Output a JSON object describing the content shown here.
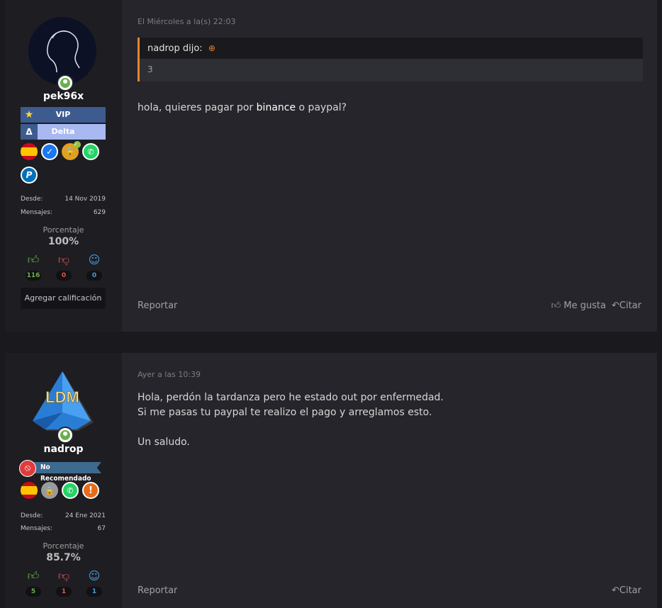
{
  "posts": [
    {
      "user": {
        "name": "pek96x",
        "banners": [
          {
            "label": "VIP",
            "bg": "#3d5b8f"
          },
          {
            "label": "Delta",
            "bg": "#a8b8f0",
            "icon": "Δ"
          }
        ],
        "badges": [
          "spain-flag-icon",
          "verified-icon",
          "lock-icon",
          "whatsapp-icon",
          "paypal-icon"
        ],
        "desde_label": "Desde:",
        "desde_value": "14 Nov 2019",
        "mensajes_label": "Mensajes:",
        "mensajes_value": "629",
        "porcentaje_label": "Porcentaje",
        "porcentaje_value": "100%",
        "votes": {
          "positive": "116",
          "negative": "0",
          "neutral": "0"
        },
        "rate_button": "Agregar calificación"
      },
      "date": "El Miércoles a la(s) 22:03",
      "quote": {
        "author": "nadrop dijo:",
        "text": "3"
      },
      "message": {
        "before": "hola, quieres pagar por ",
        "link": "binance",
        "after": " o paypal?"
      },
      "report": "Reportar",
      "like": "Me gusta",
      "cite": "Citar"
    },
    {
      "user": {
        "name": "nadrop",
        "avatar_text": "LDM",
        "banner": "No Recomendado",
        "badges": [
          "spain-flag-icon",
          "lock-gray-icon",
          "whatsapp-icon",
          "warning-icon"
        ],
        "desde_label": "Desde:",
        "desde_value": "24 Ene 2021",
        "mensajes_label": "Mensajes:",
        "mensajes_value": "67",
        "porcentaje_label": "Porcentaje",
        "porcentaje_value": "85.7%",
        "votes": {
          "positive": "5",
          "negative": "1",
          "neutral": "1"
        }
      },
      "date": "Ayer a las 10:39",
      "message_lines": [
        "Hola, perdón la tardanza pero he estado out por enfermedad.",
        "Si me pasas tu paypal te realizo el pago y arreglamos esto.",
        "Un saludo."
      ],
      "report": "Reportar",
      "cite": "Citar"
    }
  ],
  "colors": {
    "positive": "#6ab04c",
    "negative": "#e05555",
    "neutral": "#4a9fe0",
    "quote_accent": "#e6852b"
  }
}
